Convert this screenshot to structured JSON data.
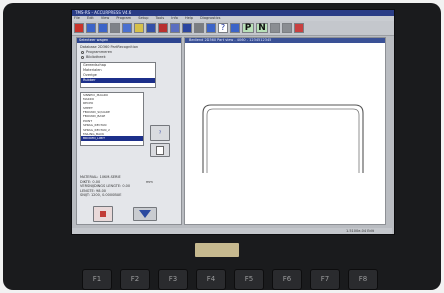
{
  "window": {
    "title": "TMS-RS - ACCURPRESS V4.6"
  },
  "menu": [
    "File",
    "Edit",
    "View",
    "Program",
    "Setup",
    "Tools",
    "Info",
    "Help",
    "Diagnostics"
  ],
  "toolbar": {
    "p_label": "P",
    "n_label": "N"
  },
  "selector": {
    "title": "Selecteer wagen",
    "subtitle": "Database 2D360 PartRecognition",
    "options": [
      "Programmeren",
      "Bibliotheek"
    ],
    "list1": [
      "Gereedschap",
      "Materialen",
      "Overige",
      "Rubber"
    ],
    "list2": [
      "SINNECI_MAGRO",
      "MAKRO",
      "RECPO",
      "SHEET",
      "FBOUND_SQUARE",
      "FBOUND_BASE",
      "POINT",
      "SPRAG_RECTAN",
      "SPRAG_RECTAN_2",
      "FAILING_BACK",
      "BROKEN_LIMIT"
    ],
    "info": [
      "MATERIAL: 10KM-SERIE",
      "DIKTE: 0.00",
      "VERSNIJDINGS LENGTE: 0.00",
      "LENGTE: 98.00",
      "SNIJT: 1200, 0.0000BUE"
    ],
    "unit": "mm"
  },
  "viewer": {
    "title": "Bediend 2D360 Part view - 4060 - 1234512345",
    "status": "1.5100e-04 Edit"
  },
  "fkeys": [
    "F1",
    "F2",
    "F3",
    "F4",
    "F5",
    "F6",
    "F7",
    "F8"
  ],
  "colors": {
    "accent": "#2d4590"
  }
}
